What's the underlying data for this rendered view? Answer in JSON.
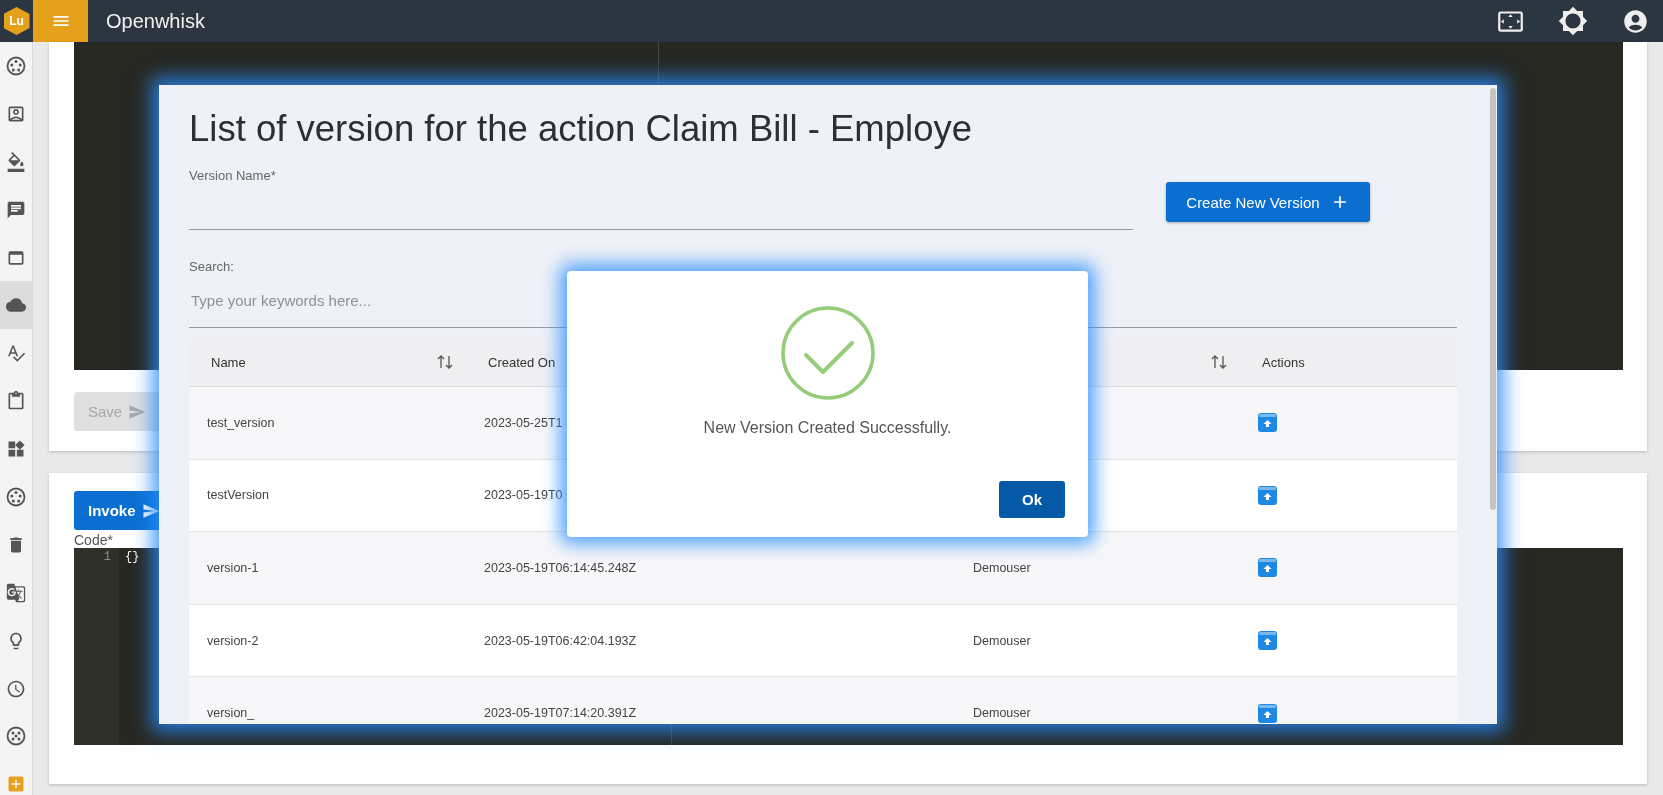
{
  "top_bar": {
    "logo": "Lu",
    "title": "Openwhisk"
  },
  "sidebar": {
    "items": [
      {
        "selected": false
      },
      {
        "selected": false
      },
      {
        "selected": false
      },
      {
        "selected": false
      },
      {
        "selected": false
      },
      {
        "selected": true
      },
      {
        "selected": false
      },
      {
        "selected": false
      },
      {
        "selected": false
      },
      {
        "selected": false
      },
      {
        "selected": false
      },
      {
        "selected": false
      },
      {
        "selected": false
      },
      {
        "selected": false
      },
      {
        "selected": false
      },
      {
        "selected": false
      }
    ]
  },
  "background": {
    "save_button": {
      "label": "Save",
      "disabled": true
    },
    "invoke_button": {
      "label": "Invoke",
      "disabled": false
    },
    "code_label": "Code*",
    "code_lines": [
      {
        "number": "1",
        "text": "{}"
      }
    ]
  },
  "modal": {
    "title": "List of version for the action Claim Bill - Employe",
    "version_name": {
      "label": "Version Name*"
    },
    "create_button": "Create New Version",
    "search": {
      "label": "Search:",
      "placeholder": "Type your keywords here..."
    },
    "table": {
      "columns": [
        {
          "label": "Name",
          "sortable": true
        },
        {
          "label": "Created On"
        },
        {
          "sortable": true
        },
        {
          "label": "Actions",
          "sortable": false
        }
      ],
      "rows": [
        {
          "name": "test_version",
          "created_on": "2023-05-25T1"
        },
        {
          "name": "testVersion",
          "created_on": "2023-05-19T0"
        },
        {
          "name": "version-1",
          "created_on": "2023-05-19T06:14:45.248Z",
          "column_3": "Demouser"
        },
        {
          "name": "version-2",
          "created_on": "2023-05-19T06:42:04.193Z",
          "column_3": "Demouser"
        },
        {
          "name": "version_",
          "created_on": "2023-05-19T07:14:20.391Z",
          "column_3": "Demouser"
        }
      ]
    }
  },
  "dialog": {
    "message": "New Version Created Successfully.",
    "ok_button": "Ok"
  }
}
